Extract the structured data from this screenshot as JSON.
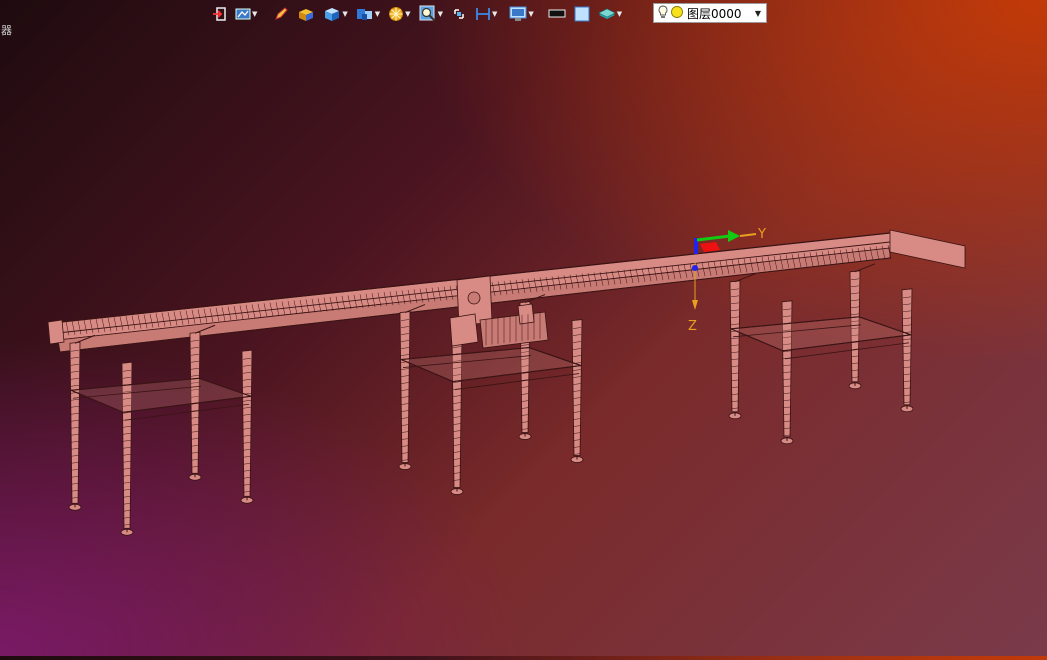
{
  "toolbar": {
    "items": [
      {
        "icon": "exit-arrow-icon"
      },
      {
        "icon": "display-mode-icon",
        "dropdown": true
      },
      {
        "icon": "pencil-icon"
      },
      {
        "icon": "solid-box-icon"
      },
      {
        "icon": "view-cube-icon",
        "dropdown": true
      },
      {
        "icon": "projection-icon",
        "dropdown": true
      },
      {
        "icon": "render-sphere-icon",
        "dropdown": true
      },
      {
        "icon": "zoom-lens-icon",
        "dropdown": true
      },
      {
        "icon": "rotate-icon"
      },
      {
        "icon": "dimension-icon",
        "dropdown": true
      },
      {
        "icon": "monitor-settings-icon",
        "dropdown": true
      },
      {
        "icon": "line-color-icon"
      },
      {
        "icon": "fill-color-icon"
      },
      {
        "icon": "layer-stack-icon",
        "dropdown": true
      }
    ]
  },
  "layer": {
    "current": "图层0000",
    "icons": [
      "lightbulb-icon",
      "sun-icon"
    ]
  },
  "triad": {
    "y_label": "Y",
    "z_label": "Z",
    "colors": {
      "x": "#e11",
      "y": "#1c1",
      "z": "#22e",
      "labels": "#e8a020"
    }
  },
  "corner_glyph": "器",
  "colors": {
    "model": "#d88a84",
    "model_edge": "#3a1414",
    "accent": "#c23a08"
  }
}
